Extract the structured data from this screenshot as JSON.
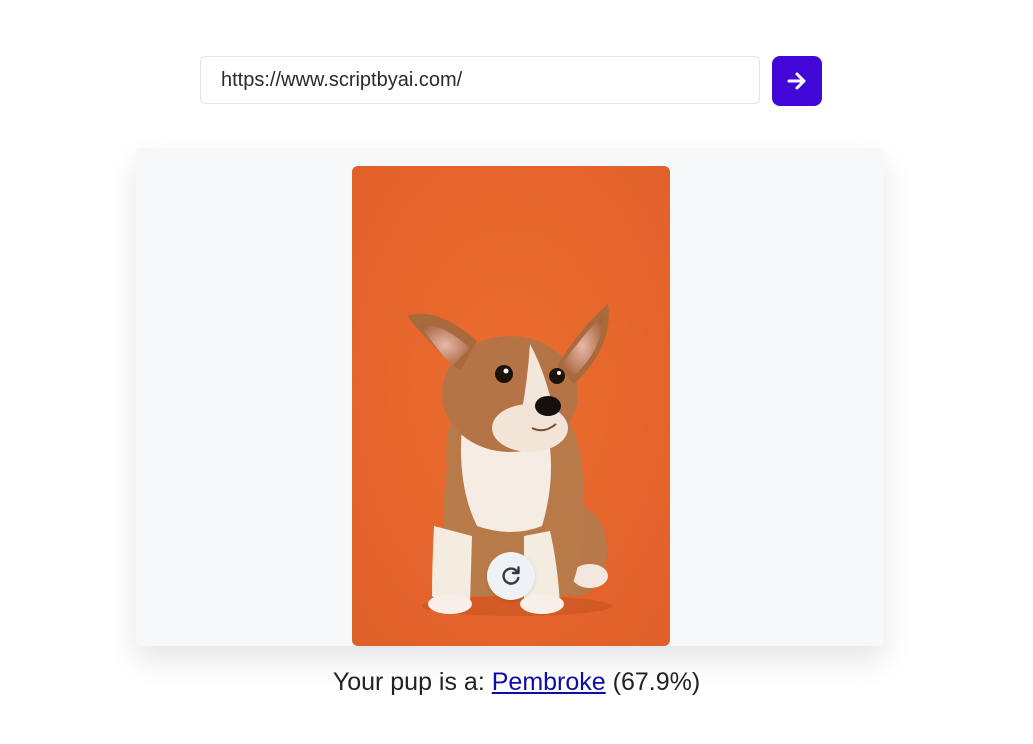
{
  "url_bar": {
    "value": "https://www.scriptbyai.com/"
  },
  "go_button": {
    "icon": "arrow-right-icon",
    "color": "#4108d8"
  },
  "photo": {
    "subject": "corgi puppy",
    "background_color": "#e8672a"
  },
  "refresh_button": {
    "icon": "refresh-icon"
  },
  "result": {
    "prefix": "Your pup is a:",
    "breed": "Pembroke",
    "confidence": "(67.9%)"
  }
}
